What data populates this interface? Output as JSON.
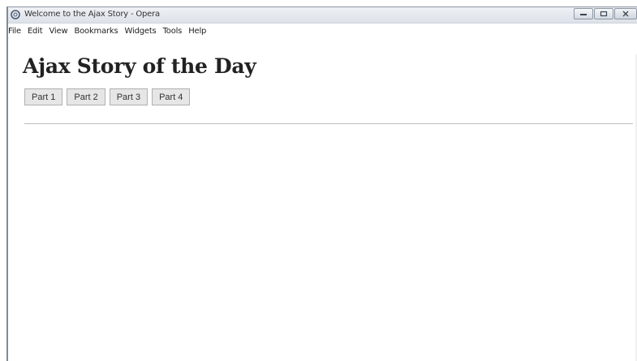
{
  "window": {
    "title": "Welcome to the Ajax Story - Opera"
  },
  "menu": {
    "items": [
      "File",
      "Edit",
      "View",
      "Bookmarks",
      "Widgets",
      "Tools",
      "Help"
    ]
  },
  "page": {
    "heading": "Ajax Story of the Day",
    "parts": [
      "Part 1",
      "Part 2",
      "Part 3",
      "Part 4"
    ]
  },
  "icons": {
    "app": "opera-icon",
    "minimize": "minimize-icon",
    "maximize": "maximize-icon",
    "close": "close-icon"
  },
  "colors": {
    "button_bg": "#e6e6e6",
    "button_border": "#b0b0b0",
    "divider": "#bdbdbd"
  }
}
